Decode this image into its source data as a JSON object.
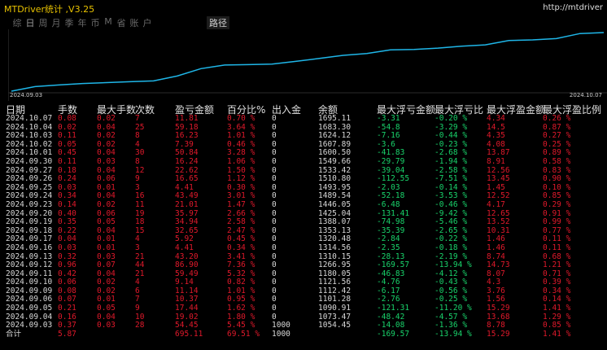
{
  "window": {
    "title": "MTDriver统计 ,V3.25",
    "url": "http://mtdriver"
  },
  "tabs": [
    {
      "label": "综"
    },
    {
      "label": "日"
    },
    {
      "label": "周"
    },
    {
      "label": "月"
    },
    {
      "label": "季"
    },
    {
      "label": "年"
    },
    {
      "label": "币"
    },
    {
      "label": "M"
    },
    {
      "label": "省"
    },
    {
      "label": "账"
    },
    {
      "label": "户"
    },
    {
      "label": "路径"
    }
  ],
  "chart": {
    "date_start": "2024.09.03",
    "date_end": "2024.10.07",
    "line_color": "#1fb6e8"
  },
  "columns": [
    "日期",
    "手数",
    "最大手数",
    "次数",
    "盈亏金额",
    "百分比%",
    "出入金",
    "余额",
    "最大浮亏金额",
    "最大浮亏比",
    "最大浮盈金额",
    "最大浮盈比例"
  ],
  "rows": [
    [
      "2024.10.07",
      "0.08",
      "0.02",
      "7",
      "11.81",
      "0.70 %",
      "0",
      "1695.11",
      "-3.31",
      "-0.20 %",
      "4.34",
      "0.26 %"
    ],
    [
      "2024.10.04",
      "0.02",
      "0.04",
      "25",
      "59.18",
      "3.64 %",
      "0",
      "1683.30",
      "-54.8",
      "-3.29 %",
      "14.5",
      "0.87 %"
    ],
    [
      "2024.10.03",
      "0.11",
      "0.02",
      "8",
      "16.23",
      "1.01 %",
      "0",
      "1624.12",
      "-7.16",
      "-0.44 %",
      "4.35",
      "0.27 %"
    ],
    [
      "2024.10.02",
      "0.05",
      "0.02",
      "4",
      "7.39",
      "0.46 %",
      "0",
      "1607.89",
      "-3.6",
      "-0.23 %",
      "4.08",
      "0.25 %"
    ],
    [
      "2024.10.01",
      "0.45",
      "0.04",
      "30",
      "50.84",
      "3.28 %",
      "0",
      "1600.50",
      "-41.83",
      "-2.68 %",
      "13.87",
      "0.89 %"
    ],
    [
      "2024.09.30",
      "0.11",
      "0.03",
      "8",
      "16.24",
      "1.06 %",
      "0",
      "1549.66",
      "-29.79",
      "-1.94 %",
      "8.91",
      "0.58 %"
    ],
    [
      "2024.09.27",
      "0.18",
      "0.04",
      "12",
      "22.62",
      "1.50 %",
      "0",
      "1533.42",
      "-39.04",
      "-2.58 %",
      "12.56",
      "0.83 %"
    ],
    [
      "2024.09.26",
      "0.24",
      "0.06",
      "9",
      "16.65",
      "1.12 %",
      "0",
      "1510.80",
      "-112.55",
      "-7.51 %",
      "13.45",
      "0.90 %"
    ],
    [
      "2024.09.25",
      "0.03",
      "0.01",
      "3",
      "4.41",
      "0.30 %",
      "0",
      "1493.95",
      "-2.03",
      "-0.14 %",
      "1.45",
      "0.10 %"
    ],
    [
      "2024.09.24",
      "0.34",
      "0.04",
      "16",
      "43.49",
      "3.01 %",
      "0",
      "1489.54",
      "-52.18",
      "-3.53 %",
      "12.52",
      "0.85 %"
    ],
    [
      "2024.09.23",
      "0.14",
      "0.02",
      "11",
      "21.01",
      "1.47 %",
      "0",
      "1446.05",
      "-6.48",
      "-0.46 %",
      "4.17",
      "0.29 %"
    ],
    [
      "2024.09.20",
      "0.40",
      "0.06",
      "19",
      "35.97",
      "2.66 %",
      "0",
      "1425.04",
      "-131.41",
      "-9.42 %",
      "12.65",
      "0.91 %"
    ],
    [
      "2024.09.19",
      "0.35",
      "0.05",
      "18",
      "34.94",
      "2.58 %",
      "0",
      "1388.07",
      "-74.98",
      "-5.46 %",
      "13.52",
      "0.99 %"
    ],
    [
      "2024.09.18",
      "0.22",
      "0.04",
      "15",
      "32.65",
      "2.47 %",
      "0",
      "1353.13",
      "-35.39",
      "-2.65 %",
      "10.31",
      "0.77 %"
    ],
    [
      "2024.09.17",
      "0.04",
      "0.01",
      "4",
      "5.92",
      "0.45 %",
      "0",
      "1320.48",
      "-2.84",
      "-0.22 %",
      "1.46",
      "0.11 %"
    ],
    [
      "2024.09.16",
      "0.03",
      "0.01",
      "3",
      "4.41",
      "0.34 %",
      "0",
      "1314.56",
      "-2.35",
      "-0.18 %",
      "1.46",
      "0.11 %"
    ],
    [
      "2024.09.13",
      "0.32",
      "0.03",
      "21",
      "43.20",
      "3.41 %",
      "0",
      "1310.15",
      "-28.13",
      "-2.19 %",
      "8.74",
      "0.68 %"
    ],
    [
      "2024.09.12",
      "0.96",
      "0.07",
      "44",
      "86.90",
      "7.36 %",
      "0",
      "1266.95",
      "-169.57",
      "-13.94 %",
      "14.73",
      "1.21 %"
    ],
    [
      "2024.09.11",
      "0.42",
      "0.04",
      "21",
      "59.49",
      "5.32 %",
      "0",
      "1180.05",
      "-46.83",
      "-4.12 %",
      "8.07",
      "0.71 %"
    ],
    [
      "2024.09.10",
      "0.06",
      "0.02",
      "4",
      "9.14",
      "0.82 %",
      "0",
      "1121.56",
      "-4.76",
      "-0.43 %",
      "4.3",
      "0.39 %"
    ],
    [
      "2024.09.09",
      "0.08",
      "0.02",
      "6",
      "11.14",
      "1.01 %",
      "0",
      "1112.42",
      "-6.17",
      "-0.56 %",
      "3.76",
      "0.34 %"
    ],
    [
      "2024.09.06",
      "0.07",
      "0.01",
      "7",
      "10.37",
      "0.95 %",
      "0",
      "1101.28",
      "-2.76",
      "-0.25 %",
      "1.56",
      "0.14 %"
    ],
    [
      "2024.09.05",
      "0.21",
      "0.05",
      "9",
      "17.44",
      "1.62 %",
      "0",
      "1090.91",
      "-121.31",
      "-11.20 %",
      "15.29",
      "1.41 %"
    ],
    [
      "2024.09.04",
      "0.16",
      "0.04",
      "10",
      "19.02",
      "1.80 %",
      "0",
      "1073.47",
      "-48.42",
      "-4.57 %",
      "13.68",
      "1.29 %"
    ],
    [
      "2024.09.03",
      "0.37",
      "0.03",
      "28",
      "54.45",
      "5.45 %",
      "1000",
      "1054.45",
      "-14.08",
      "-1.36 %",
      "8.78",
      "0.85 %"
    ]
  ],
  "total": [
    "合计",
    "5.87",
    "",
    "",
    "695.11",
    "69.51 %",
    "1000",
    "",
    "-169.57",
    "-13.94 %",
    "15.29",
    "1.41 %"
  ]
}
